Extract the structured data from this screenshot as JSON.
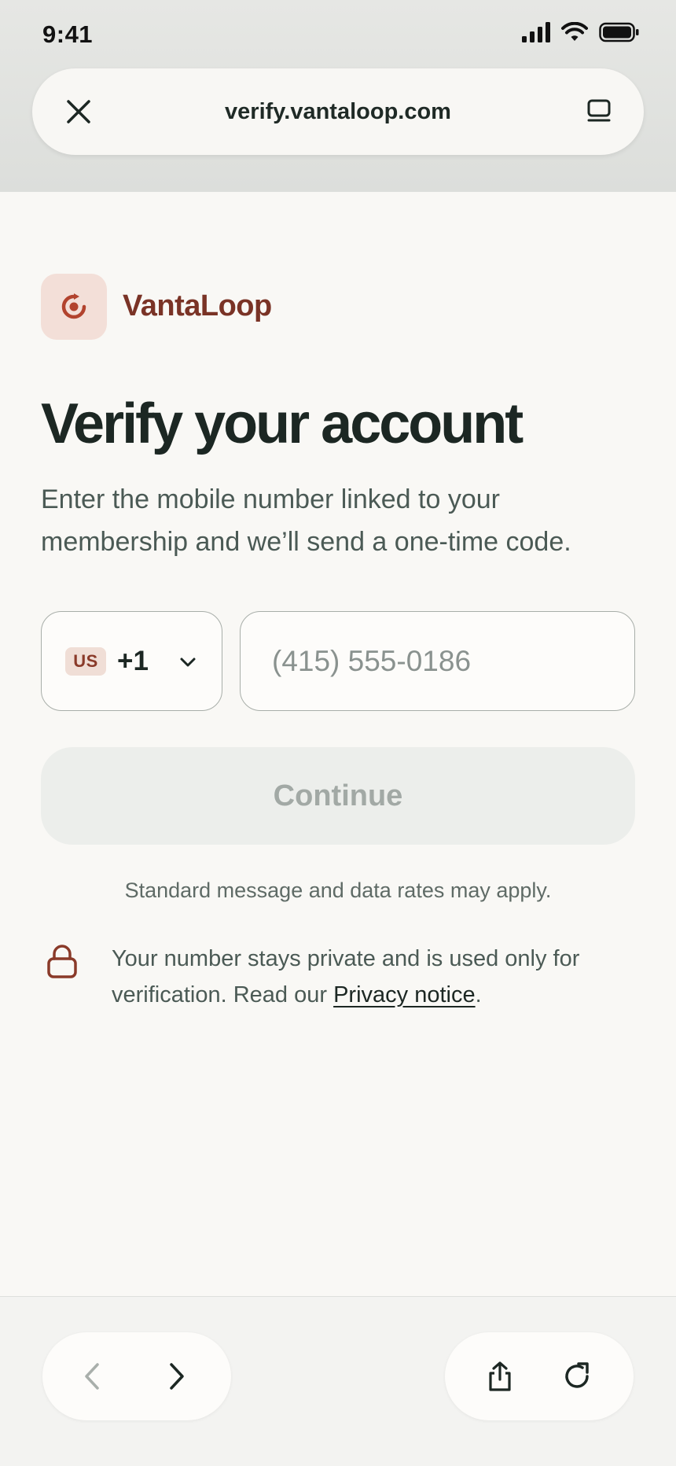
{
  "status_bar": {
    "time": "9:41",
    "icons": [
      "cellular-signal-icon",
      "wifi-icon",
      "battery-icon"
    ]
  },
  "browser": {
    "url": "verify.vantaloop.com",
    "close_icon": "close-icon",
    "tabs_icon": "tabs-icon"
  },
  "brand": {
    "name": "VantaLoop",
    "logo_icon": "loop-logo-icon",
    "accent_color": "#7a3326"
  },
  "page": {
    "title": "Verify your account",
    "subtitle": "Enter the mobile number linked to your membership and we’ll send a one-time code."
  },
  "form": {
    "country": {
      "badge": "US",
      "code": "+1"
    },
    "phone": {
      "placeholder": "(415) 555-0186",
      "value": ""
    },
    "continue_label": "Continue",
    "continue_disabled": true
  },
  "notes": {
    "rates": "Standard message and data rates may apply.",
    "privacy_prefix": "Your number stays private and is used only for verification. Read our ",
    "privacy_link": "Privacy notice",
    "privacy_suffix": "."
  },
  "toolbar": {
    "icons": [
      "back-icon",
      "forward-icon",
      "share-icon",
      "reload-icon"
    ]
  }
}
